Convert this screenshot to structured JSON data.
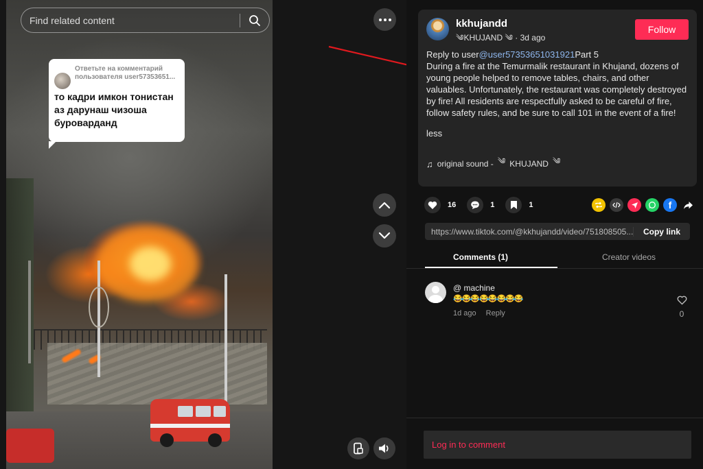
{
  "search": {
    "placeholder": "Find related content"
  },
  "reply_sticker": {
    "caption_line1": "Ответьте на комментарий",
    "caption_line2": "пользователя user57353651...",
    "text": "то кадри имкон тонистан аз дарунаш чизоша бурövардand"
  },
  "author": {
    "name": "kkhujandd",
    "display_name": "KHUJAND",
    "time_ago": "3d ago",
    "follow_label": "Follow"
  },
  "description": {
    "prefix": "Reply to user",
    "mention": "@user57353651031921",
    "suffix": "Part 5",
    "body": "During a fire at the Temurmalik restaurant in Khujand, dozens of young people helped to remove tables, chairs, and other valuables. Unfortunately, the restaurant was completely destroyed by fire! All residents are respectfully asked to be careful of fire, follow safety rules, and be sure to call 101 in the event of a fire!",
    "less_label": "less"
  },
  "sound": {
    "label": "original sound -",
    "artist": "KHUJAND"
  },
  "actions": {
    "likes": "16",
    "comments": "1",
    "saves": "1"
  },
  "share_icons": [
    {
      "name": "repost-icon",
      "color": "#f2c200"
    },
    {
      "name": "embed-icon",
      "color": "#3a3a3a"
    },
    {
      "name": "send-icon",
      "color": "#fe2c55"
    },
    {
      "name": "whatsapp-icon",
      "color": "#25d366"
    },
    {
      "name": "facebook-icon",
      "color": "#1877f2"
    }
  ],
  "link": {
    "url": "https://www.tiktok.com/@kkhujandd/video/751808505...",
    "copy_label": "Copy link"
  },
  "tabs": [
    {
      "label": "Comments (1)"
    },
    {
      "label": "Creator videos"
    }
  ],
  "comment": {
    "user": "@ machine",
    "text": "😂😂😂😂😂😂😂😂",
    "time": "1d ago",
    "reply_label": "Reply",
    "likes": "0"
  },
  "login": {
    "label": "Log in to comment"
  },
  "colors": {
    "accent": "#fe2c55",
    "mention": "#8fb7ee",
    "annotation_arrow": "#e0191e"
  }
}
